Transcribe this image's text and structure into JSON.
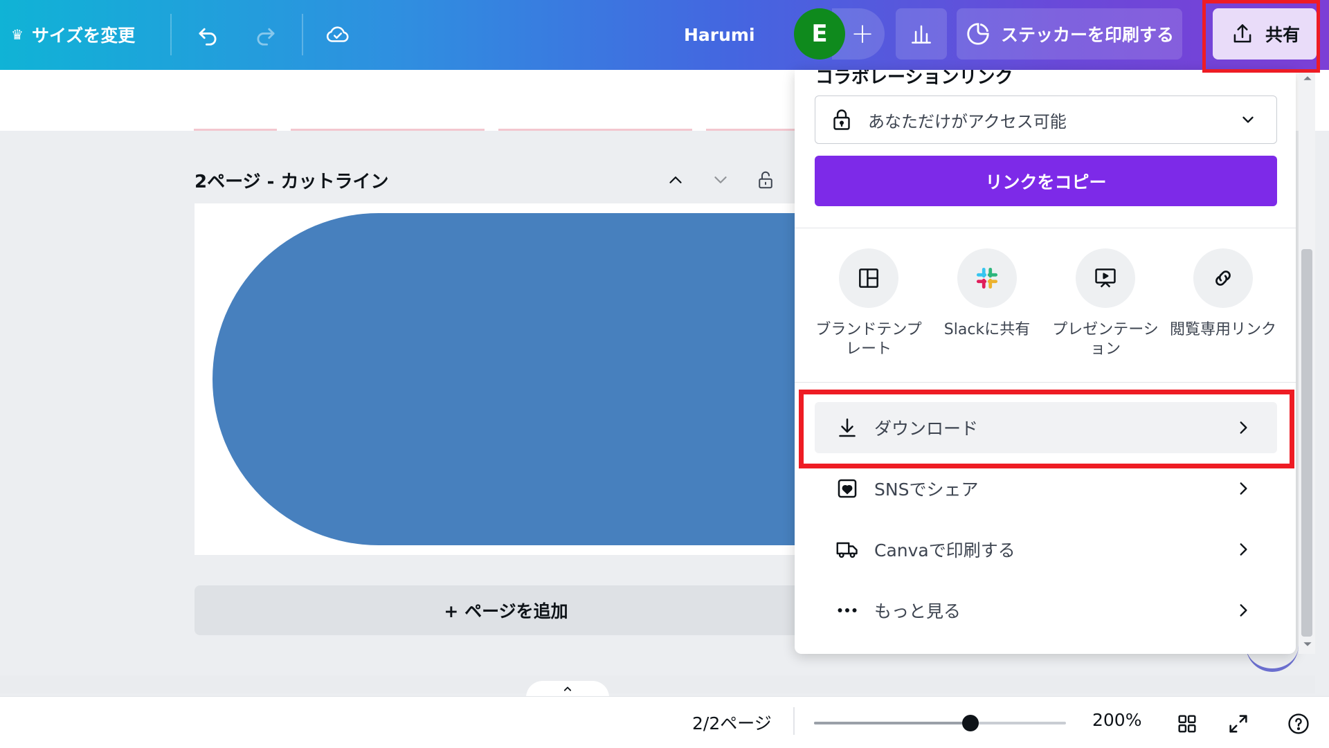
{
  "topbar": {
    "resize_label": "サイズを変更",
    "crown_glyph": "♛",
    "username": "Harumi",
    "avatar_initial": "E",
    "add_glyph": "+",
    "sticker_label": "ステッカーを印刷する",
    "share_label": "共有"
  },
  "editor": {
    "page_label": "2ページ - カットライン",
    "add_page_label": "+ ページを追加",
    "shape_color": "#4780be"
  },
  "footer": {
    "page_count": "2/2ページ",
    "zoom_label": "200%",
    "zoom_fraction": 0.62
  },
  "share_panel": {
    "title": "コラボレーションリンク",
    "access_label": "あなただけがアクセス可能",
    "copy_link_label": "リンクをコピー",
    "options": [
      {
        "label": "ブランドテンプレート",
        "icon": "template-icon"
      },
      {
        "label": "Slackに共有",
        "icon": "slack-icon"
      },
      {
        "label": "プレゼンテーション",
        "icon": "presentation-icon"
      },
      {
        "label": "閲覧専用リンク",
        "icon": "link-icon"
      }
    ],
    "rows": [
      {
        "label": "ダウンロード",
        "icon": "download-icon"
      },
      {
        "label": "SNSでシェア",
        "icon": "heart-icon"
      },
      {
        "label": "Canvaで印刷する",
        "icon": "truck-icon"
      },
      {
        "label": "もっと見る",
        "icon": "more-icon"
      }
    ]
  },
  "colors": {
    "accent_purple": "#7d2ae8",
    "highlight_red": "#ee1c24",
    "avatar_green": "#0f8a1d"
  }
}
